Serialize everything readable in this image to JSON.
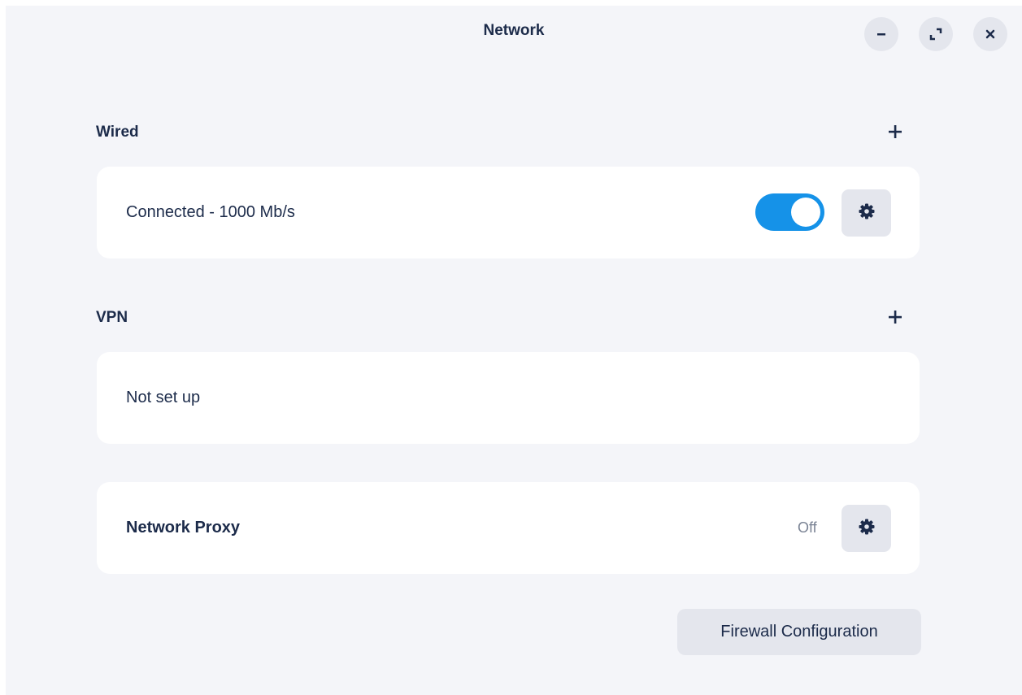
{
  "window": {
    "title": "Network",
    "controls": {
      "minimize_icon": "minimize-icon",
      "maximize_icon": "maximize-icon",
      "close_icon": "close-icon"
    }
  },
  "wired": {
    "section_title": "Wired",
    "add_icon": "plus-icon",
    "status_text": "Connected - 1000 Mb/s",
    "toggle_on": true,
    "settings_icon": "gear-icon"
  },
  "vpn": {
    "section_title": "VPN",
    "add_icon": "plus-icon",
    "status_text": "Not set up"
  },
  "proxy": {
    "label": "Network Proxy",
    "status": "Off",
    "settings_icon": "gear-icon"
  },
  "firewall": {
    "button_label": "Firewall Configuration"
  },
  "colors": {
    "accent": "#1592e8",
    "background": "#f4f5f9",
    "card": "#ffffff",
    "text": "#1c2b4a",
    "muted_text": "#7a8394",
    "button_bg": "#e4e6ed"
  }
}
